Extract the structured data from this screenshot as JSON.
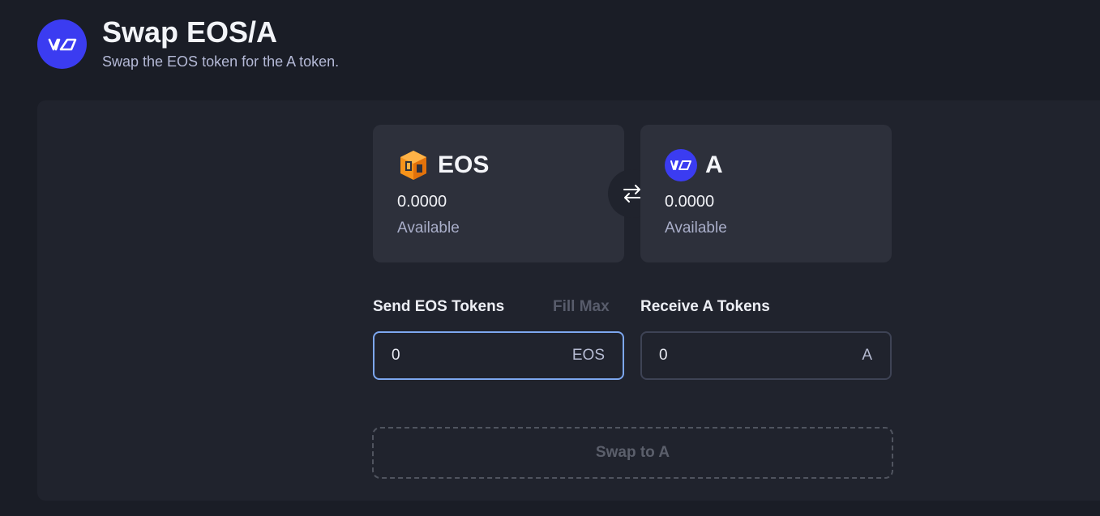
{
  "header": {
    "title": "Swap EOS/A",
    "subtitle": "Swap the EOS token for the A token.",
    "logo_icon": "brand-logo-icon"
  },
  "from_token": {
    "symbol": "EOS",
    "balance": "0.0000",
    "available_label": "Available",
    "icon": "eos-token-icon"
  },
  "to_token": {
    "symbol": "A",
    "balance": "0.0000",
    "available_label": "Available",
    "icon": "a-token-icon"
  },
  "switch": {
    "icon": "swap-arrows-icon"
  },
  "send": {
    "label": "Send EOS Tokens",
    "fill_max_label": "Fill Max",
    "value": "0",
    "unit": "EOS"
  },
  "receive": {
    "label": "Receive A Tokens",
    "value": "0",
    "unit": "A"
  },
  "action": {
    "label": "Swap to A"
  },
  "colors": {
    "background": "#1a1d26",
    "panel": "#20232d",
    "card": "#2d303b",
    "brand": "#3b3cf1",
    "eos_orange": "#f7931a",
    "focus_border": "#7da7ef"
  }
}
